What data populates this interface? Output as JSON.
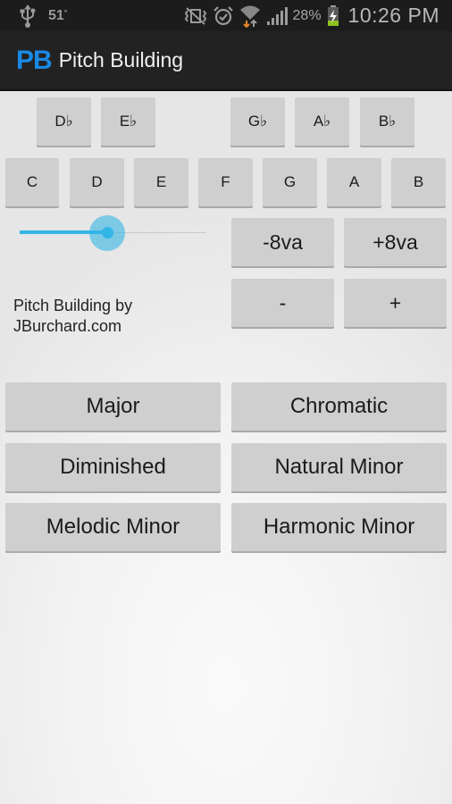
{
  "status_bar": {
    "icons_left": [
      "usb-icon"
    ],
    "temperature": "51",
    "temperature_unit": "°",
    "icons_right": [
      "vibrate-mute-icon",
      "alarm-icon",
      "wifi-icon",
      "signal-icon",
      "battery-charging-icon"
    ],
    "battery_percent": "28%",
    "time": "10:26 PM"
  },
  "action_bar": {
    "logo": "PB",
    "title": "Pitch Building",
    "logo_color": "#1a8ae5"
  },
  "flat_keys": [
    {
      "label": "D♭"
    },
    {
      "label": "E♭"
    },
    {
      "label": "G♭"
    },
    {
      "label": "A♭"
    },
    {
      "label": "B♭"
    }
  ],
  "natural_keys": [
    {
      "label": "C"
    },
    {
      "label": "D"
    },
    {
      "label": "E"
    },
    {
      "label": "F"
    },
    {
      "label": "G"
    },
    {
      "label": "A"
    },
    {
      "label": "B"
    }
  ],
  "slider": {
    "value_fraction": 0.47,
    "accent_color": "#33b5e5"
  },
  "octave_controls": {
    "down_octave": "-8va",
    "up_octave": "+8va",
    "minus": "-",
    "plus": "+"
  },
  "credit": {
    "line1": "Pitch Building by",
    "line2": "JBurchard.com"
  },
  "scales": [
    {
      "label": "Major"
    },
    {
      "label": "Chromatic"
    },
    {
      "label": "Diminished"
    },
    {
      "label": "Natural Minor"
    },
    {
      "label": "Melodic Minor"
    },
    {
      "label": "Harmonic Minor"
    }
  ]
}
